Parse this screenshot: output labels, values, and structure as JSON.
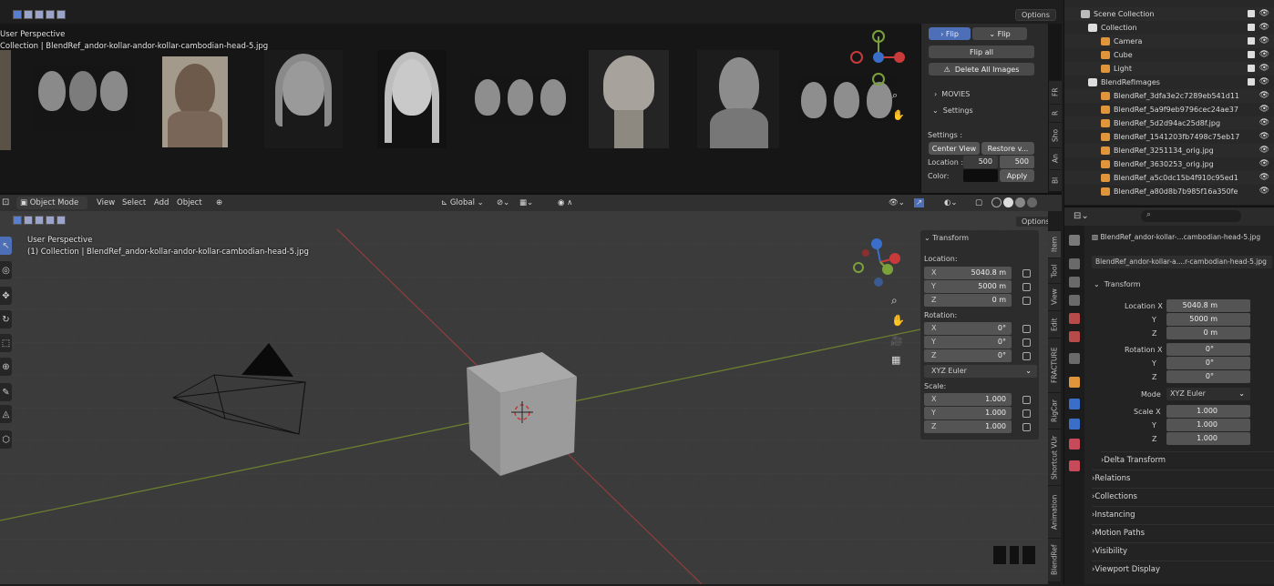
{
  "top_view": {
    "mode_icons": [
      "select-box-icon",
      "select-extend-icon",
      "select-subtract-icon",
      "select-invert-icon",
      "select-intersect-icon"
    ],
    "options_label": "Options",
    "perspective": "User Perspective",
    "object_info": "(1) Collection | BlendRef_andor-kollar-andor-kollar-cambodian-head-5.jpg",
    "object_info_short": "Collection | BlendRef_andor-kollar-andor-kollar-cambodian-head-5.jpg"
  },
  "blendref_panel": {
    "flip_btn": "Flip",
    "flip_btn2": "Flip",
    "flip_all": "Flip all",
    "delete_all": "Delete All Images",
    "movies": "MOVIES",
    "settings_header": "Settings",
    "settings_label": "Settings :",
    "center_view": "Center View",
    "restore_view": "Restore v...",
    "location_label": "Location :",
    "location_x": "500",
    "location_y": "500",
    "color_label": "Color:",
    "apply": "Apply",
    "tabs": [
      "FR",
      "R",
      "Sho",
      "An",
      "Bl"
    ]
  },
  "main_header": {
    "mode": "Object Mode",
    "menus": [
      "View",
      "Select",
      "Add",
      "Object"
    ],
    "transform_orientation": "Global",
    "options_label": "Options"
  },
  "main_view": {
    "perspective": "User Perspective",
    "object_info": "(1) Collection | BlendRef_andor-kollar-andor-kollar-cambodian-head-5.jpg"
  },
  "n_panel": {
    "header": "Transform",
    "location_label": "Location:",
    "location": [
      {
        "k": "X",
        "v": "5040.8 m"
      },
      {
        "k": "Y",
        "v": "5000 m"
      },
      {
        "k": "Z",
        "v": "0 m"
      }
    ],
    "rotation_label": "Rotation:",
    "rotation": [
      {
        "k": "X",
        "v": "0°"
      },
      {
        "k": "Y",
        "v": "0°"
      },
      {
        "k": "Z",
        "v": "0°"
      }
    ],
    "rotation_mode": "XYZ Euler",
    "scale_label": "Scale:",
    "scale": [
      {
        "k": "X",
        "v": "1.000"
      },
      {
        "k": "Y",
        "v": "1.000"
      },
      {
        "k": "Z",
        "v": "1.000"
      }
    ],
    "tabs": [
      "Item",
      "Tool",
      "View",
      "Edit",
      "FRACTURE",
      "RigCar",
      "Shortcut VUr",
      "Animation",
      "BlendRef"
    ]
  },
  "outliner": {
    "rows": [
      {
        "label": "Scene Collection",
        "color": "#bbbbbb"
      },
      {
        "label": "Collection",
        "color": "#dddddd"
      },
      {
        "label": "Camera",
        "color": "#e0953a"
      },
      {
        "label": "Cube",
        "color": "#e0953a"
      },
      {
        "label": "Light",
        "color": "#e0953a"
      },
      {
        "label": "BlendRefImages",
        "color": "#dddddd"
      },
      {
        "label": "BlendRef_3dfa3e2c7289eb541d11",
        "color": "#e0953a"
      },
      {
        "label": "BlendRef_5a9f9eb9796cec24ae37",
        "color": "#e0953a"
      },
      {
        "label": "BlendRef_5d2d94ac25d8f.jpg",
        "color": "#e0953a"
      },
      {
        "label": "BlendRef_1541203fb7498c75eb17",
        "color": "#e0953a"
      },
      {
        "label": "BlendRef_3251134_orig.jpg",
        "color": "#e0953a"
      },
      {
        "label": "BlendRef_3630253_orig.jpg",
        "color": "#e0953a"
      },
      {
        "label": "BlendRef_a5c0dc15b4f910c95ed1",
        "color": "#e0953a"
      },
      {
        "label": "BlendRef_a80d8b7b985f16a350fe",
        "color": "#e0953a"
      }
    ]
  },
  "properties": {
    "object_name": "BlendRef_andor-kollar-...cambodian-head-5.jpg",
    "object_name2": "BlendRef_andor-kollar-a....r-cambodian-head-5.jpg",
    "transform_header": "Transform",
    "location_label": "Location X",
    "location": [
      "5040.8 m",
      "5000 m",
      "0 m"
    ],
    "rotation_label": "Rotation X",
    "rotation": [
      "0°",
      "0°",
      "0°"
    ],
    "mode_label": "Mode",
    "mode": "XYZ Euler",
    "scale_label": "Scale X",
    "scale": [
      "1.000",
      "1.000",
      "1.000"
    ],
    "axis_y": "Y",
    "axis_z": "Z",
    "sections": [
      "Delta Transform",
      "Relations",
      "Collections",
      "Instancing",
      "Motion Paths",
      "Visibility",
      "Viewport Display"
    ]
  }
}
